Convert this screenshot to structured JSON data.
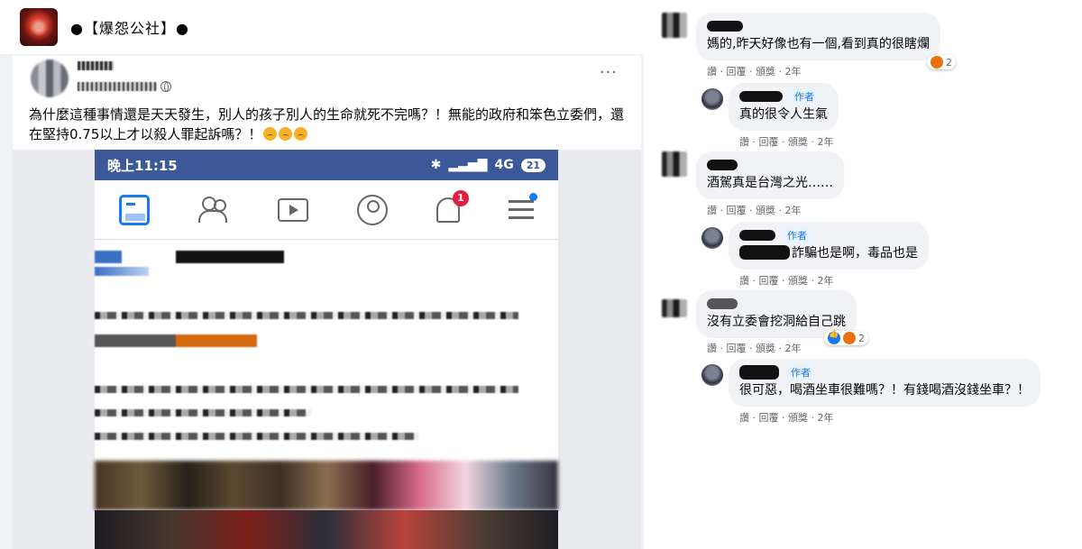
{
  "group": {
    "name": "●【爆怨公社】●"
  },
  "post": {
    "more_label": "···",
    "text": "為什麼這種事情還是天天發生，別人的孩子別人的生命就死不完嗎？！無能的政府和笨色立委們，還在堅持0.75以上才以殺人罪起訴嗎？！",
    "phone": {
      "time": "晚上11:15",
      "network": "4G",
      "battery": "21",
      "notification_count": "1"
    }
  },
  "comments": [
    {
      "text": "媽的,昨天好像也有一個,看到真的很瞎爛",
      "actions": "讚 · 回覆 · 頒獎 · 2年",
      "reaction_count": "2"
    },
    {
      "tag": "作者",
      "text": "真的很令人生氣",
      "actions": "讚 · 回覆 · 頒獎 · 2年"
    },
    {
      "text": "酒駕真是台灣之光……",
      "actions": "讚 · 回覆 · 頒獎 · 2年"
    },
    {
      "tag": "作者",
      "text": "詐騙也是啊，毒品也是",
      "actions": "讚 · 回覆 · 頒獎 · 2年"
    },
    {
      "text": "沒有立委會挖洞給自己跳",
      "actions": "讚 · 回覆 · 頒獎 · 2年",
      "reaction_count": "2"
    },
    {
      "tag": "作者",
      "text": "很可惡，喝酒坐車很難嗎？！有錢喝酒沒錢坐車？！",
      "actions": "讚 · 回覆 · 頒獎 · 2年"
    }
  ]
}
